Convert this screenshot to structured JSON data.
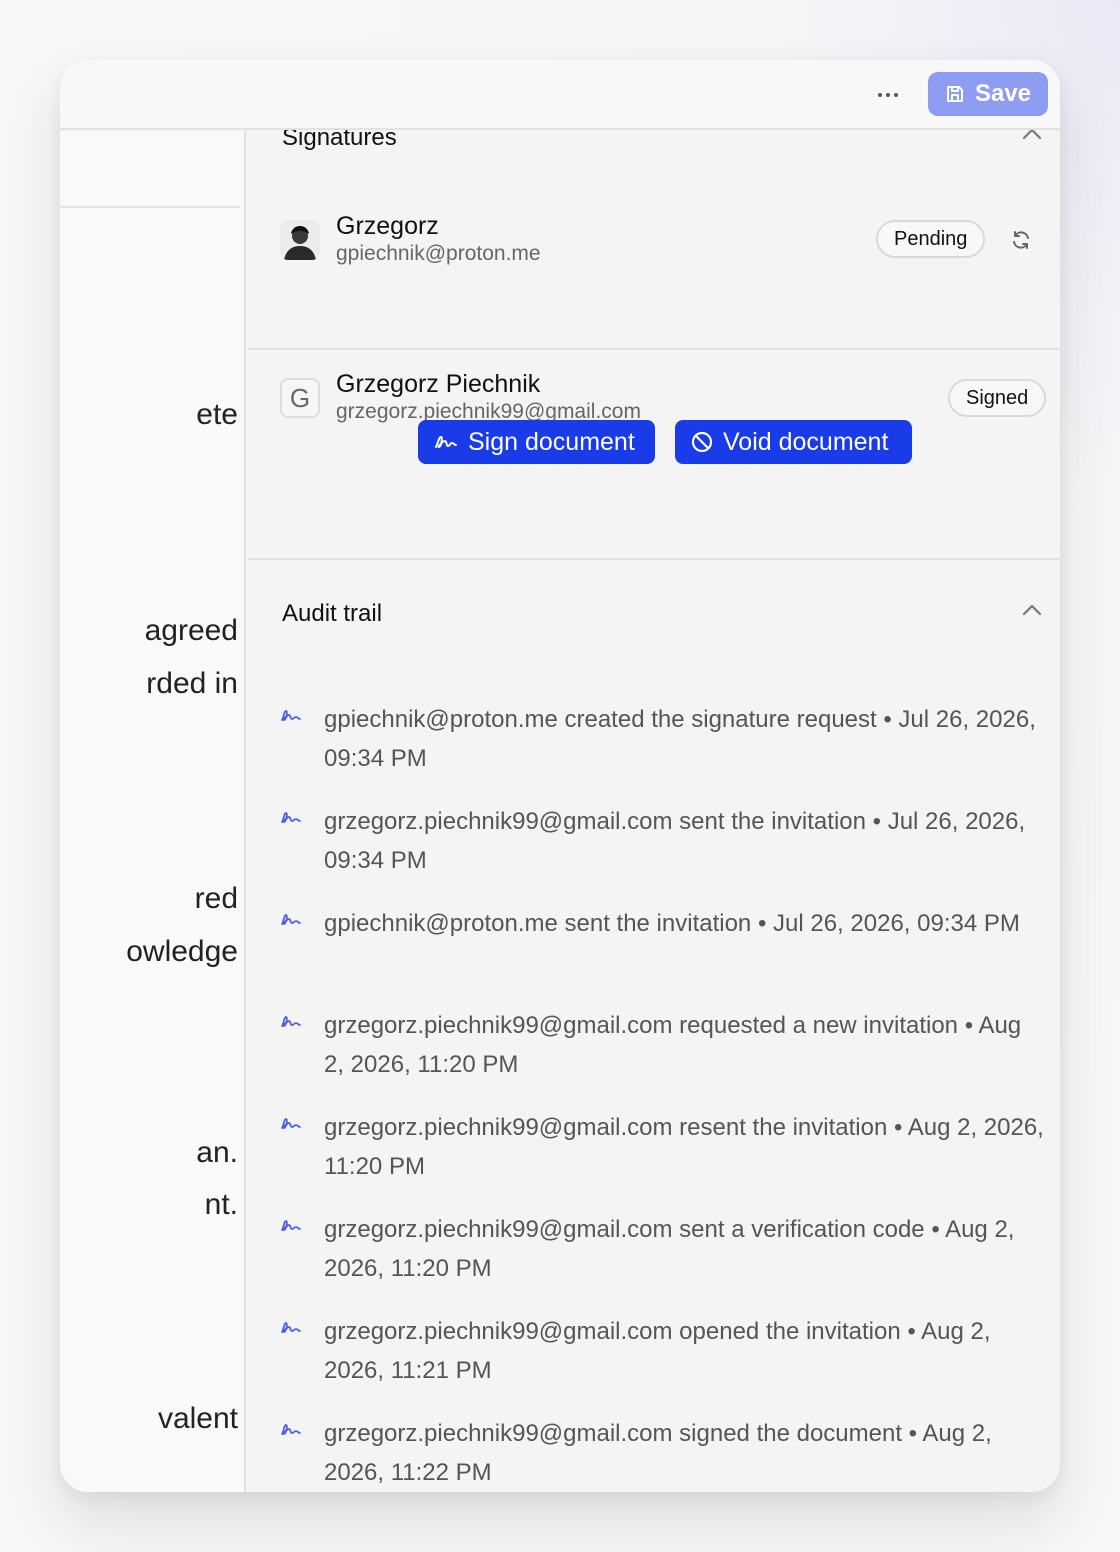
{
  "toolbar": {
    "save_label": "Save",
    "more_icon": "more-horizontal-icon",
    "save_icon": "floppy-disk-icon",
    "save_color": "#8e9cf2"
  },
  "left_panel": {
    "fragments": [
      "ete",
      "agreed",
      "rded in",
      "red",
      "owledge",
      "an.",
      "nt.",
      "valent"
    ]
  },
  "signatures": {
    "title": "Signatures",
    "signers": [
      {
        "name": "Grzegorz",
        "email": "gpiechnik@proton.me",
        "status": "Pending",
        "avatar": "photo"
      },
      {
        "name": "Grzegorz Piechnik",
        "email": "grzegorz.piechnik99@gmail.com",
        "status": "Signed",
        "avatar_letter": "G"
      }
    ],
    "sign_button": "Sign document",
    "void_button": "Void document",
    "button_color": "#1a3be8"
  },
  "audit_trail": {
    "title": "Audit trail",
    "icon": "signature-icon",
    "icon_color": "#4f5fe0",
    "entries": [
      "gpiechnik@proton.me created the signature request • Jul 26, 2026, 09:34 PM",
      "grzegorz.piechnik99@gmail.com sent the invitation • Jul 26, 2026, 09:34 PM",
      "gpiechnik@proton.me sent the invitation • Jul 26, 2026, 09:34 PM",
      "grzegorz.piechnik99@gmail.com requested a new invitation • Aug 2, 2026, 11:20 PM",
      "grzegorz.piechnik99@gmail.com resent the invitation • Aug 2, 2026, 11:20 PM",
      "grzegorz.piechnik99@gmail.com sent a verification code • Aug 2, 2026, 11:20 PM",
      "grzegorz.piechnik99@gmail.com opened the invitation • Aug 2, 2026, 11:21 PM",
      "grzegorz.piechnik99@gmail.com signed the document • Aug 2, 2026, 11:22 PM"
    ]
  }
}
